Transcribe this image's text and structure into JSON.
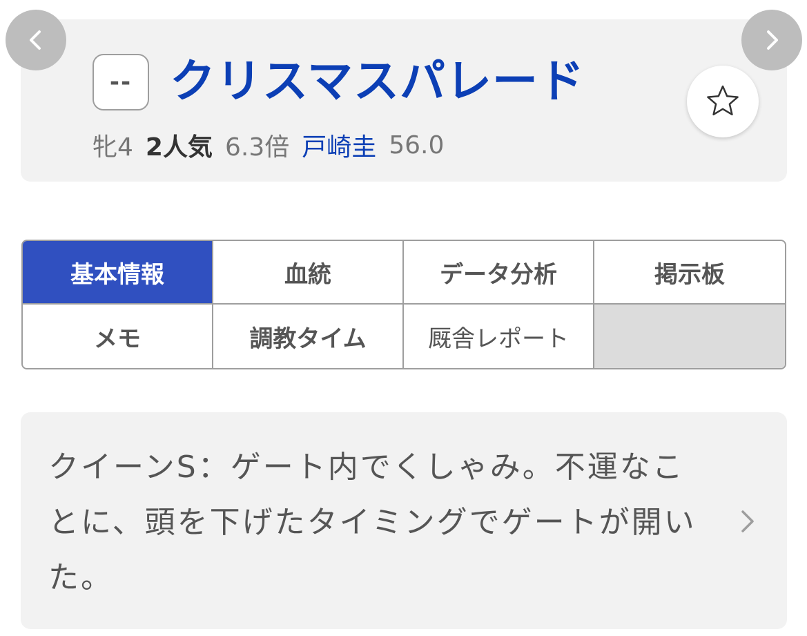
{
  "header": {
    "number_badge": "--",
    "horse_name": "クリスマスパレード",
    "sex_age": "牝4",
    "popularity": "2人気",
    "odds": "6.3倍",
    "jockey": "戸崎圭",
    "weight": "56.0",
    "prev_icon": "chevron-left-icon",
    "next_icon": "chevron-right-icon",
    "favorite_icon": "star-outline-icon"
  },
  "tabs": [
    {
      "label": "基本情報",
      "active": true
    },
    {
      "label": "血統",
      "active": false
    },
    {
      "label": "データ分析",
      "active": false
    },
    {
      "label": "掲示板",
      "active": false
    },
    {
      "label": "メモ",
      "active": false
    },
    {
      "label": "調教タイム",
      "active": false
    },
    {
      "label": "厩舎レポート",
      "active": false
    }
  ],
  "memo": {
    "text": "クイーンS：ゲート内でくしゃみ。不運なことに、頭を下げたタイミングでゲートが開いた。",
    "chevron_icon": "chevron-right-icon"
  },
  "colors": {
    "accent_blue": "#0c3fb5",
    "active_tab": "#3050c0",
    "card_bg": "#f2f2f2",
    "empty_cell": "#dcdcdc"
  }
}
